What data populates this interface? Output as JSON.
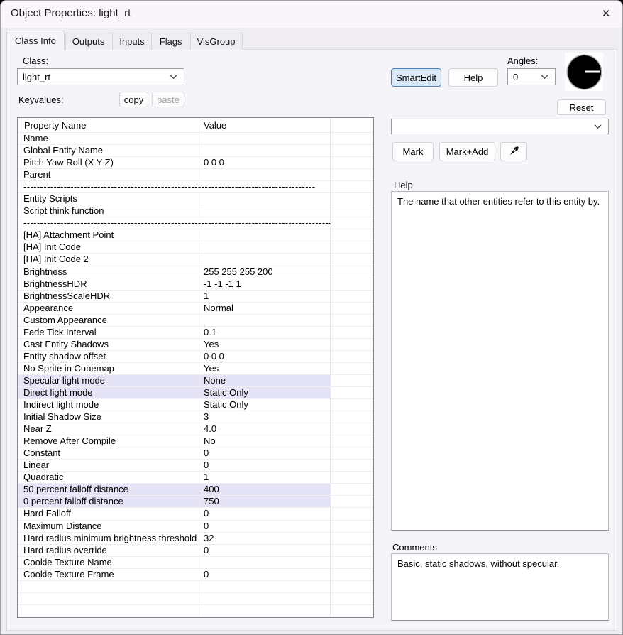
{
  "window": {
    "title": "Object Properties: light_rt",
    "close_glyph": "✕"
  },
  "tabs": [
    {
      "label": "Class Info",
      "active": true
    },
    {
      "label": "Outputs",
      "active": false
    },
    {
      "label": "Inputs",
      "active": false
    },
    {
      "label": "Flags",
      "active": false
    },
    {
      "label": "VisGroup",
      "active": false
    }
  ],
  "class_section": {
    "label": "Class:",
    "value": "light_rt",
    "keyvalues_label": "Keyvalues:",
    "copy_label": "copy",
    "paste_label": "paste"
  },
  "toolbar": {
    "smartedit_label": "SmartEdit",
    "help_label": "Help",
    "angles_label": "Angles:",
    "angles_value": "0",
    "reset_label": "Reset"
  },
  "selector": {
    "value": "",
    "mark_label": "Mark",
    "mark_add_label": "Mark+Add",
    "eyedropper_icon": "eyedropper"
  },
  "help_panel": {
    "label": "Help",
    "text": "The name that other entities refer to this entity by."
  },
  "comments_panel": {
    "label": "Comments",
    "text": "Basic, static shadows, without specular."
  },
  "colors": {
    "row_highlight": "#e4e4f6",
    "smartedit_bg": "#d9e9f7",
    "smartedit_border": "#4a7fba",
    "angle_dial": "#000000",
    "angle_needle": "#ffffff"
  },
  "table": {
    "headers": [
      "Property Name",
      "Value"
    ],
    "divider_dashes": "--------------------------------------------------------------------------------------------------------------------------------------------",
    "rows": [
      {
        "name": "Name",
        "value": ""
      },
      {
        "name": "Global Entity Name",
        "value": ""
      },
      {
        "name": "Pitch Yaw Roll (X Y Z)",
        "value": "0 0 0"
      },
      {
        "name": "Parent",
        "value": ""
      },
      {
        "divider": "short"
      },
      {
        "name": "Entity Scripts",
        "value": ""
      },
      {
        "name": "Script think function",
        "value": ""
      },
      {
        "divider": "long"
      },
      {
        "name": "[HA] Attachment Point",
        "value": ""
      },
      {
        "name": "[HA] Init Code",
        "value": ""
      },
      {
        "name": "[HA] Init Code 2",
        "value": ""
      },
      {
        "name": "Brightness",
        "value": "255 255 255 200"
      },
      {
        "name": "BrightnessHDR",
        "value": "-1 -1 -1 1"
      },
      {
        "name": "BrightnessScaleHDR",
        "value": "1"
      },
      {
        "name": "Appearance",
        "value": "Normal"
      },
      {
        "name": "Custom Appearance",
        "value": ""
      },
      {
        "name": "Fade Tick Interval",
        "value": "0.1"
      },
      {
        "name": "Cast Entity Shadows",
        "value": "Yes"
      },
      {
        "name": "Entity shadow offset",
        "value": "0 0 0"
      },
      {
        "name": "No Sprite in Cubemap",
        "value": "Yes"
      },
      {
        "name": "Specular light mode",
        "value": "None",
        "highlight": true
      },
      {
        "name": "Direct light mode",
        "value": "Static Only",
        "highlight": true
      },
      {
        "name": "Indirect light mode",
        "value": "Static Only"
      },
      {
        "name": "Initial Shadow Size",
        "value": "3"
      },
      {
        "name": "Near Z",
        "value": "4.0"
      },
      {
        "name": "Remove After Compile",
        "value": "No"
      },
      {
        "name": "Constant",
        "value": "0"
      },
      {
        "name": "Linear",
        "value": "0"
      },
      {
        "name": "Quadratic",
        "value": "1"
      },
      {
        "name": "50 percent falloff distance",
        "value": "400",
        "highlight": true
      },
      {
        "name": "0 percent falloff distance",
        "value": "750",
        "highlight": true
      },
      {
        "name": "Hard Falloff",
        "value": "0"
      },
      {
        "name": "Maximum Distance",
        "value": "0"
      },
      {
        "name": "Hard radius minimum brightness threshold",
        "value": "32"
      },
      {
        "name": "Hard radius override",
        "value": "0"
      },
      {
        "name": "Cookie Texture Name",
        "value": ""
      },
      {
        "name": "Cookie Texture Frame",
        "value": "0"
      },
      {
        "name": "",
        "value": ""
      },
      {
        "name": "",
        "value": ""
      },
      {
        "name": "",
        "value": ""
      }
    ]
  }
}
